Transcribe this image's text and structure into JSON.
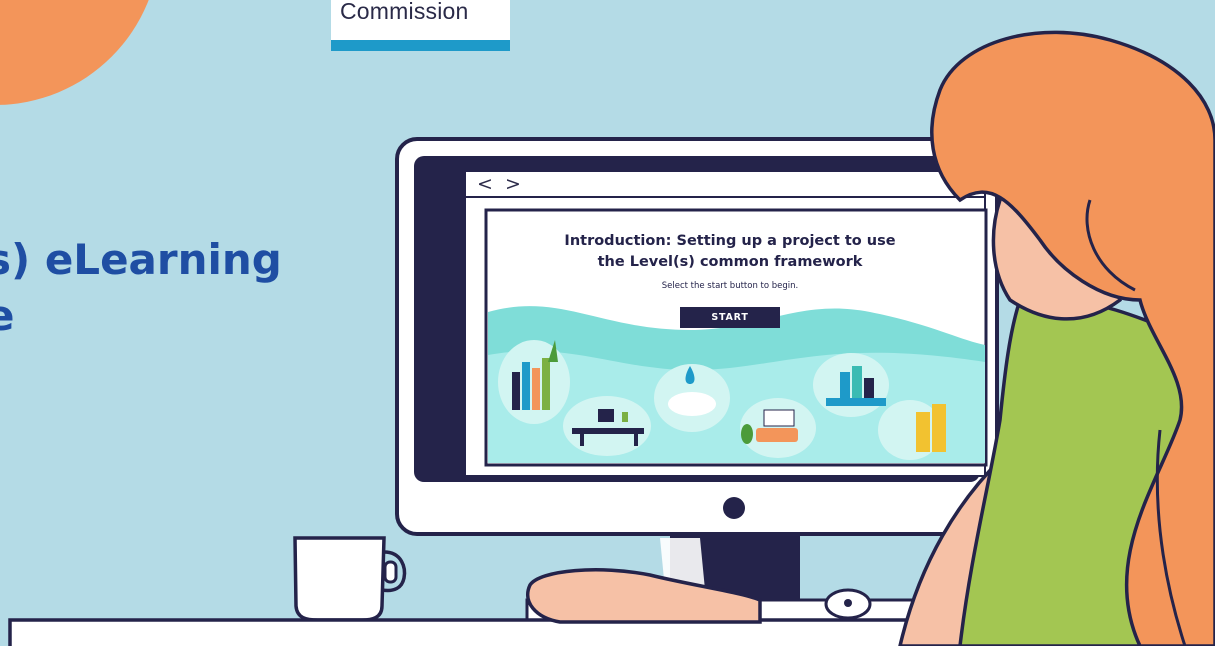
{
  "logo": {
    "text": "Commission"
  },
  "course": {
    "title": "s) eLearning\ne"
  },
  "browser": {
    "back_icon": "<",
    "forward_icon": ">"
  },
  "slide": {
    "heading": "Introduction: Setting up a project to use\nthe Level(s) common framework",
    "instruction": "Select the start button to begin.",
    "start_label": "START"
  },
  "colors": {
    "background": "#b4dbe6",
    "accent_orange": "#f3955a",
    "navy": "#24234a",
    "title_blue": "#1f4ea3",
    "logo_blue": "#1e9ac9",
    "shirt_green": "#a3c652",
    "skin": "#f6c1a6",
    "wave_teal": "#7fddd8"
  }
}
